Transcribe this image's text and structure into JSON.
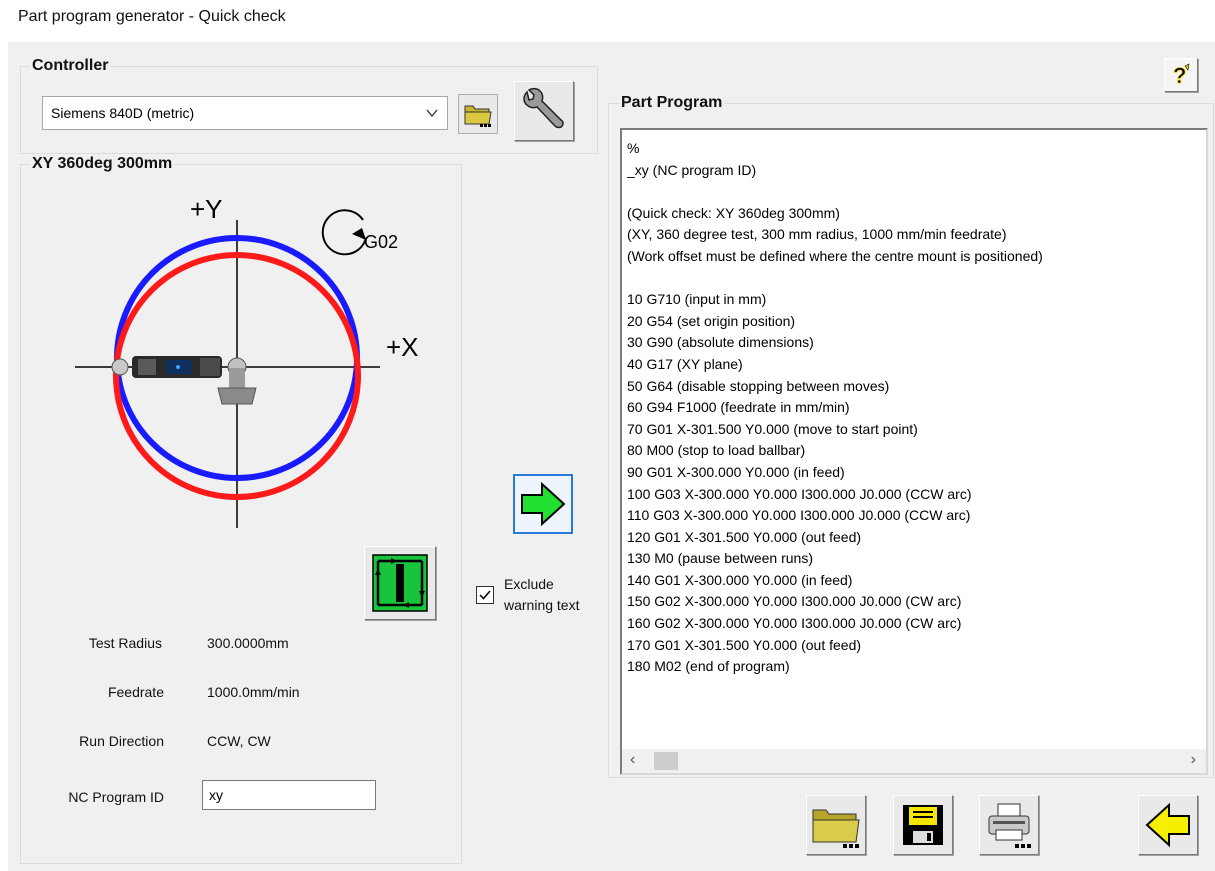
{
  "window": {
    "title": "Part program generator - Quick check"
  },
  "controller": {
    "title": "Controller",
    "selected": "Siemens 840D (metric)"
  },
  "test": {
    "title": "XY 360deg 300mm",
    "diagram": {
      "plus_y": "+Y",
      "plus_x": "+X",
      "g_code": "G02",
      "colors": {
        "ccw": "#1a1aff",
        "cw": "#ff1a1a"
      }
    },
    "fields": [
      {
        "label": "Test Radius",
        "value": "300.0000mm"
      },
      {
        "label": "Feedrate",
        "value": "1000.0mm/min"
      },
      {
        "label": "Run Direction",
        "value": "CCW, CW"
      }
    ],
    "nc_program_id": {
      "label": "NC Program ID",
      "value": "xy"
    }
  },
  "options": {
    "exclude_warning": {
      "line1": "Exclude",
      "line2": "warning text",
      "checked": true
    }
  },
  "program": {
    "title": "Part Program",
    "lines": [
      "%",
      "_xy (NC program ID)",
      "",
      "(Quick check: XY 360deg 300mm)",
      "(XY, 360 degree test, 300 mm radius, 1000 mm/min feedrate)",
      "(Work offset must be defined where the centre mount is positioned)",
      "",
      "10 G710 (input in mm)",
      "20 G54 (set origin position)",
      "30 G90 (absolute dimensions)",
      "40 G17 (XY plane)",
      "50 G64 (disable stopping between moves)",
      "60 G94 F1000 (feedrate in mm/min)",
      "70 G01 X-301.500 Y0.000 (move to start point)",
      "80 M00 (stop to load ballbar)",
      "90 G01 X-300.000 Y0.000 (in feed)",
      "100 G03 X-300.000 Y0.000 I300.000 J0.000 (CCW arc)",
      "110 G03 X-300.000 Y0.000 I300.000 J0.000 (CCW arc)",
      "120 G01 X-301.500 Y0.000 (out feed)",
      "130 M0 (pause between runs)",
      "140 G01 X-300.000 Y0.000 (in feed)",
      "150 G02 X-300.000 Y0.000 I300.000 J0.000 (CW arc)",
      "160 G02 X-300.000 Y0.000 I300.000 J0.000 (CW arc)",
      "170 G01 X-301.500 Y0.000 (out feed)",
      "180 M02 (end of program)"
    ]
  },
  "icons": {
    "help": "help-icon",
    "open_controller": "folder-icon",
    "settings": "wrench-icon",
    "generate": "green-arrow-right-icon",
    "test_type": "square-test-icon",
    "open": "folder-icon",
    "save": "floppy-disk-icon",
    "print": "printer-icon",
    "back": "yellow-arrow-left-icon"
  }
}
